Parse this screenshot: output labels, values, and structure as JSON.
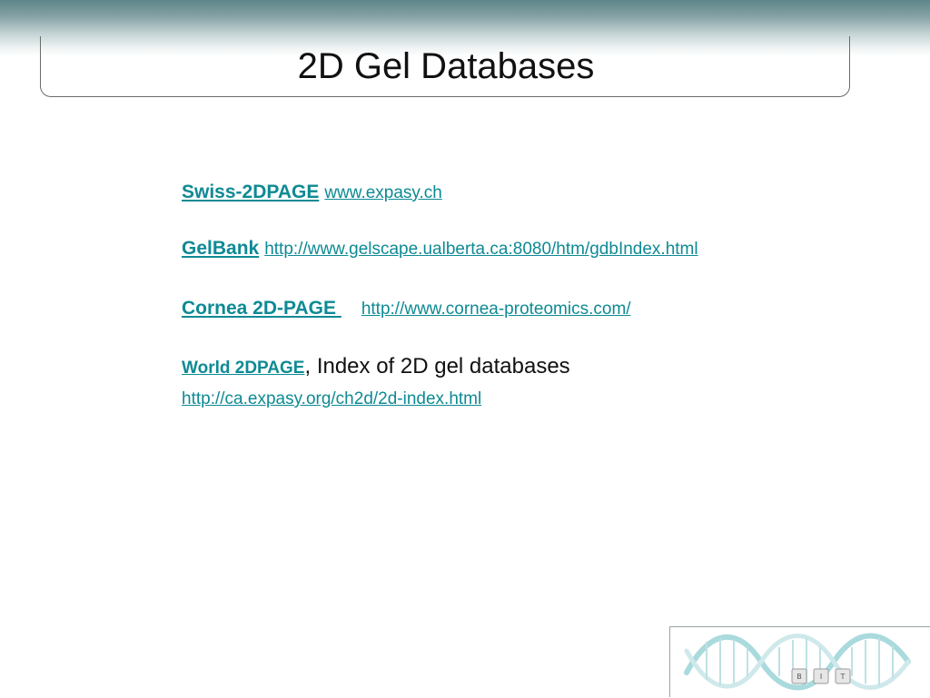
{
  "slide": {
    "title": "2D Gel Databases"
  },
  "entries": [
    {
      "name": "Swiss-2DPAGE",
      "url": "www.expasy.ch"
    },
    {
      "name": "GelBank",
      "url": "http://www.gelscape.ualberta.ca:8080/htm/gdbIndex.html"
    },
    {
      "name": "Cornea 2D-PAGE ",
      "url": "http://www.cornea-proteomics.com/"
    },
    {
      "name": "World 2DPAGE",
      "desc": ", Index of 2D gel databases",
      "url": "http://ca.expasy.org/ch2d/2d-index.html"
    }
  ],
  "logo": {
    "letters": [
      "B",
      "I",
      "T"
    ]
  },
  "colors": {
    "link": "#0e8a94",
    "band": "#5e8589",
    "text": "#111111"
  }
}
